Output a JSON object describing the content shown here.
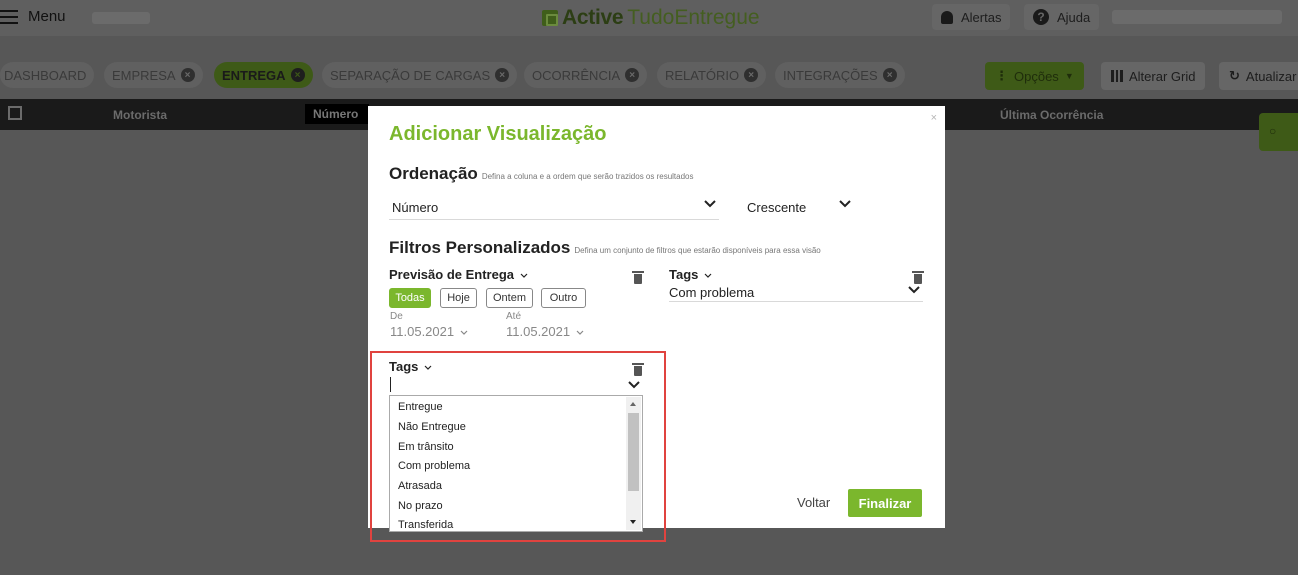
{
  "topbar": {
    "menu_label": "Menu",
    "logo_bold": "Active",
    "logo_rest": "TudoEntregue",
    "alerts_label": "Alertas",
    "help_label": "Ajuda",
    "help_icon_char": "?"
  },
  "tabs": [
    {
      "label": "Dashboard",
      "closable": false
    },
    {
      "label": "Empresa",
      "closable": true
    },
    {
      "label": "Entrega",
      "closable": true,
      "active": true
    },
    {
      "label": "Separação de Cargas",
      "closable": true
    },
    {
      "label": "Ocorrência",
      "closable": true
    },
    {
      "label": "Relatório",
      "closable": true
    },
    {
      "label": "Integrações",
      "closable": true
    }
  ],
  "toolbar": {
    "options_label": "Opções",
    "grid_label": "Alterar Grid",
    "refresh_label": "Atualizar"
  },
  "table_header": {
    "motorista": "Motorista",
    "numero": "Número",
    "ultima_ocorrencia": "Última Ocorrência"
  },
  "modal": {
    "close": "×",
    "title": "Adicionar Visualização",
    "ordenacao": {
      "title": "Ordenação",
      "hint": "Defina a coluna e a ordem que serão trazidos os resultados",
      "column_value": "Número",
      "order_value": "Crescente"
    },
    "filtros": {
      "title": "Filtros Personalizados",
      "hint": "Defina um conjunto de filtros que estarão disponíveis para essa visão"
    },
    "previsao": {
      "title": "Previsão de Entrega",
      "segments": [
        "Todas",
        "Hoje",
        "Ontem",
        "Outro"
      ],
      "selected_segment": "Todas",
      "from_label": "De",
      "from_value": "11.05.2021",
      "to_label": "Até",
      "to_value": "11.05.2021"
    },
    "tags_right": {
      "title": "Tags",
      "value": "Com problema"
    },
    "tags_left": {
      "title": "Tags",
      "value": "",
      "options": [
        "Entregue",
        "Não Entregue",
        "Em trânsito",
        "Com problema",
        "Atrasada",
        "No prazo",
        "Transferida"
      ]
    },
    "back_label": "Voltar",
    "finish_label": "Finalizar"
  },
  "colors": {
    "accent": "#7bb72d",
    "overlay": "#575757",
    "highlight": "#e0433f"
  }
}
